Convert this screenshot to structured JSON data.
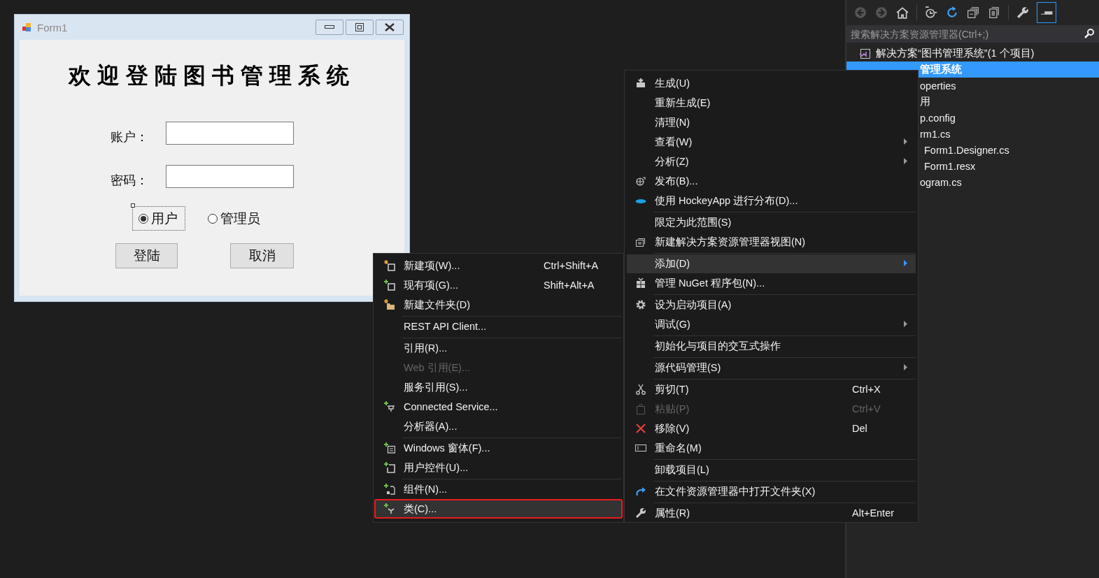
{
  "form_window": {
    "title": "Form1",
    "heading": "欢迎登陆图书管理系统",
    "fields": [
      {
        "label": "账户："
      },
      {
        "label": "密码："
      }
    ],
    "radios": [
      {
        "label": "用户",
        "selected": true,
        "focused": true
      },
      {
        "label": "管理员",
        "selected": false,
        "focused": false
      }
    ],
    "buttons": [
      "登陆",
      "取消"
    ]
  },
  "solution_explorer": {
    "search": {
      "placeholder": "搜索解决方案资源管理器(Ctrl+;)"
    },
    "tree": [
      {
        "label": "解决方案“图书管理系统”(1 个项目)",
        "selected": false,
        "children": [
          {
            "label": "管理系统",
            "selected": true,
            "children": [
              {
                "label": "operties",
                "selected": false
              },
              {
                "label": "用",
                "selected": false
              },
              {
                "label": "p.config",
                "selected": false
              },
              {
                "label": "rm1.cs",
                "selected": false,
                "children": [
                  {
                    "label": "Form1.Designer.cs",
                    "selected": false
                  },
                  {
                    "label": "Form1.resx",
                    "selected": false
                  }
                ]
              },
              {
                "label": "ogram.cs",
                "selected": false
              }
            ]
          }
        ]
      }
    ]
  },
  "context_menu": {
    "items": [
      {
        "label": "生成(U)",
        "selected": false,
        "disabled": false,
        "has_submenu": false,
        "separator_before": false
      },
      {
        "label": "重新生成(E)",
        "selected": false,
        "disabled": false,
        "has_submenu": false,
        "separator_before": false
      },
      {
        "label": "清理(N)",
        "selected": false,
        "disabled": false,
        "has_submenu": false,
        "separator_before": false
      },
      {
        "label": "查看(W)",
        "selected": false,
        "disabled": false,
        "has_submenu": true,
        "separator_before": false
      },
      {
        "label": "分析(Z)",
        "selected": false,
        "disabled": false,
        "has_submenu": true,
        "separator_before": false
      },
      {
        "label": "发布(B)...",
        "selected": false,
        "disabled": false,
        "has_submenu": false,
        "separator_before": false
      },
      {
        "label": "使用 HockeyApp 进行分布(D)...",
        "selected": false,
        "disabled": false,
        "has_submenu": false,
        "separator_before": false
      },
      {
        "label": "限定为此范围(S)",
        "selected": false,
        "disabled": false,
        "has_submenu": false,
        "separator_before": true
      },
      {
        "label": "新建解决方案资源管理器视图(N)",
        "selected": false,
        "disabled": false,
        "has_submenu": false,
        "separator_before": false
      },
      {
        "label": "添加(D)",
        "selected": true,
        "disabled": false,
        "has_submenu": true,
        "separator_before": true
      },
      {
        "label": "管理 NuGet 程序包(N)...",
        "selected": false,
        "disabled": false,
        "has_submenu": false,
        "separator_before": false
      },
      {
        "label": "设为启动项目(A)",
        "selected": false,
        "disabled": false,
        "has_submenu": false,
        "separator_before": true
      },
      {
        "label": "调试(G)",
        "selected": false,
        "disabled": false,
        "has_submenu": true,
        "separator_before": false
      },
      {
        "label": "初始化与项目的交互式操作",
        "selected": false,
        "disabled": false,
        "has_submenu": false,
        "separator_before": true
      },
      {
        "label": "源代码管理(S)",
        "selected": false,
        "disabled": false,
        "has_submenu": true,
        "separator_before": true
      },
      {
        "label": "剪切(T)",
        "shortcut": "Ctrl+X",
        "selected": false,
        "disabled": false,
        "has_submenu": false,
        "separator_before": true
      },
      {
        "label": "粘贴(P)",
        "shortcut": "Ctrl+V",
        "selected": false,
        "disabled": true,
        "has_submenu": false,
        "separator_before": false
      },
      {
        "label": "移除(V)",
        "shortcut": "Del",
        "selected": false,
        "disabled": false,
        "has_submenu": false,
        "separator_before": false
      },
      {
        "label": "重命名(M)",
        "selected": false,
        "disabled": false,
        "has_submenu": false,
        "separator_before": false
      },
      {
        "label": "卸载项目(L)",
        "selected": false,
        "disabled": false,
        "has_submenu": false,
        "separator_before": true
      },
      {
        "label": "在文件资源管理器中打开文件夹(X)",
        "selected": false,
        "disabled": false,
        "has_submenu": false,
        "separator_before": true
      },
      {
        "label": "属性(R)",
        "shortcut": "Alt+Enter",
        "selected": false,
        "disabled": false,
        "has_submenu": false,
        "separator_before": true
      }
    ]
  },
  "add_submenu": {
    "items": [
      {
        "label": "新建项(W)...",
        "shortcut": "Ctrl+Shift+A",
        "selected": false,
        "disabled": false,
        "separator_before": false
      },
      {
        "label": "现有项(G)...",
        "shortcut": "Shift+Alt+A",
        "selected": false,
        "disabled": false,
        "separator_before": false
      },
      {
        "label": "新建文件夹(D)",
        "selected": false,
        "disabled": false,
        "separator_before": false
      },
      {
        "label": "REST API Client...",
        "selected": false,
        "disabled": false,
        "separator_before": true
      },
      {
        "label": "引用(R)...",
        "selected": false,
        "disabled": false,
        "separator_before": true
      },
      {
        "label": "Web 引用(E)...",
        "selected": false,
        "disabled": true,
        "separator_before": false
      },
      {
        "label": "服务引用(S)...",
        "selected": false,
        "disabled": false,
        "separator_before": false
      },
      {
        "label": "Connected Service...",
        "selected": false,
        "disabled": false,
        "separator_before": false
      },
      {
        "label": "分析器(A)...",
        "selected": false,
        "disabled": false,
        "separator_before": false
      },
      {
        "label": "Windows 窗体(F)...",
        "selected": false,
        "disabled": false,
        "separator_before": true
      },
      {
        "label": "用户控件(U)...",
        "selected": false,
        "disabled": false,
        "separator_before": false
      },
      {
        "label": "组件(N)...",
        "selected": false,
        "disabled": false,
        "separator_before": true
      },
      {
        "label": "类(C)...",
        "selected": true,
        "disabled": false,
        "separator_before": false
      }
    ]
  }
}
